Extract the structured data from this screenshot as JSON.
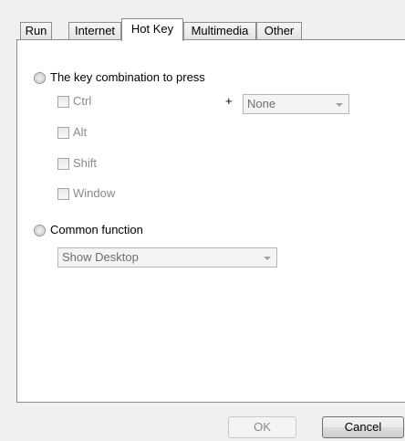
{
  "tabs": [
    "Run",
    "Internet",
    "Hot Key",
    "Multimedia",
    "Other"
  ],
  "active_tab": "Hot Key",
  "hotkey": {
    "combination_label": "The key combination to press",
    "modifiers": [
      "Ctrl",
      "Alt",
      "Shift",
      "Window"
    ],
    "plus": "+",
    "key_value": "None",
    "common_function_label": "Common function",
    "common_function_value": "Show Desktop"
  },
  "buttons": {
    "ok": "OK",
    "cancel": "Cancel"
  }
}
